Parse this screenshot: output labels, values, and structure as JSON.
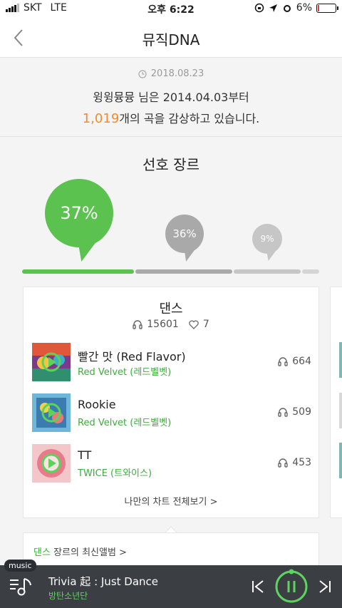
{
  "status": {
    "carrier": "SKT",
    "network": "LTE",
    "time": "오후 6:22",
    "battery": "6%"
  },
  "nav": {
    "title": "뮤직DNA"
  },
  "summary": {
    "date": "2018.08.23",
    "line1": "윙윙뮹뮹 님은 2014.04.03부터",
    "count": "1,019",
    "line2_suffix": "개의 곡을 감상하고 있습니다."
  },
  "genre": {
    "heading": "선호 장르",
    "top": {
      "label": "37%",
      "value": 37
    },
    "second": {
      "label": "36%",
      "value": 36
    },
    "third": {
      "label": "9%",
      "value": 9
    }
  },
  "card": {
    "genre_name": "댄스",
    "listens": "15601",
    "likes": "7",
    "songs": [
      {
        "title": "빨간 맛 (Red Flavor)",
        "artist": "Red Velvet (레드벨벳)",
        "plays": "664"
      },
      {
        "title": "Rookie",
        "artist": "Red Velvet (레드벨벳)",
        "plays": "509"
      },
      {
        "title": "TT",
        "artist": "TWICE (트와이스)",
        "plays": "453"
      }
    ],
    "more": "나만의 차트 전체보기 >"
  },
  "latest": {
    "genre": "댄스",
    "text": " 장르의 최신앨범 >"
  },
  "player": {
    "badge": "music",
    "title": "Trivia 起 : Just Dance",
    "artist": "방탄소년단"
  },
  "colors": {
    "accent": "#3dac3d",
    "count": "#f08b34",
    "gray_bubble": "#a9a9a9"
  }
}
